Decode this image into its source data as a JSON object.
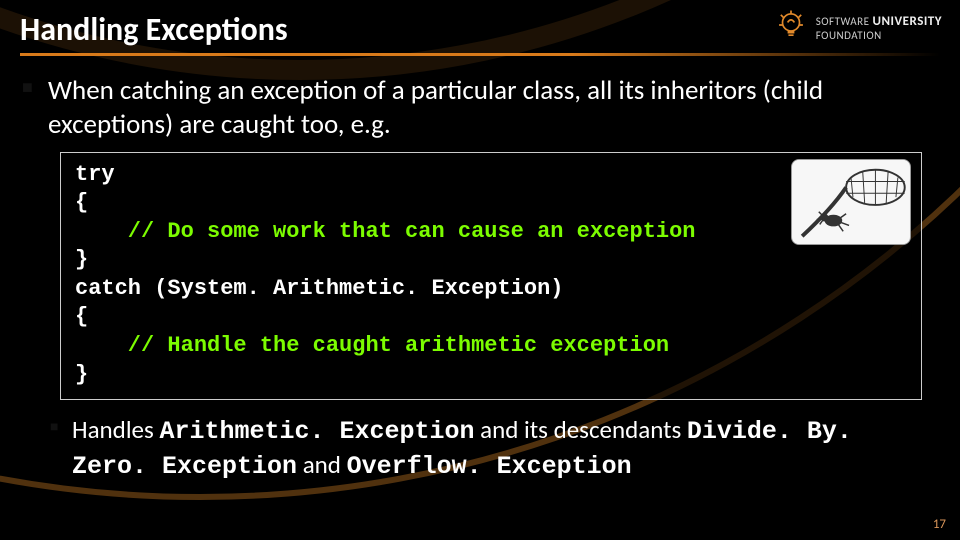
{
  "title": "Handling Exceptions",
  "logo": {
    "line1": "SOFTWARE",
    "line2": "UNIVERSITY",
    "line3": "FOUNDATION"
  },
  "bullet1": "When catching an exception of a particular class, all its inheritors (child exceptions) are caught too, e.g.",
  "code": {
    "l1": "try",
    "l2": "{",
    "l3": "    // Do some work that can cause an exception",
    "l4": "}",
    "l5": "catch (System. Arithmetic. Exception)",
    "l6": "{",
    "l7": "    // Handle the caught arithmetic exception",
    "l8": "}"
  },
  "bullet2": {
    "pre": "Handles ",
    "c1": "Arithmetic. Exception",
    "mid1": " and its descendants ",
    "c2": "Divide. By. Zero. Exception",
    "mid2": " and ",
    "c3": "Overflow. Exception"
  },
  "pagenum": "17",
  "illustration": "net-catching-bug-icon"
}
